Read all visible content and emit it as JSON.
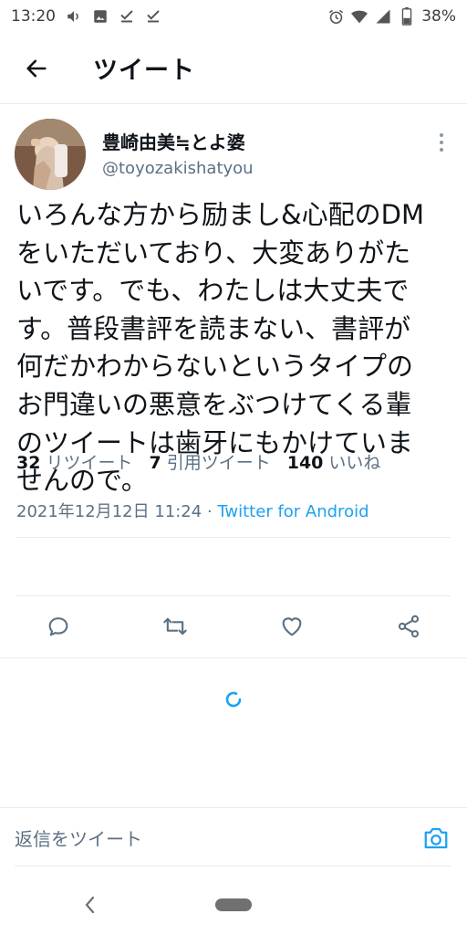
{
  "status_bar": {
    "time": "13:20",
    "battery": "38%"
  },
  "app_bar": {
    "title": "ツイート"
  },
  "tweet": {
    "author_name": "豊崎由美≒とよ婆",
    "author_handle": "@toyozakishatyou",
    "text_lines": [
      "いろんな方から励まし&心配のDM",
      "をいただいており、大変ありがた",
      "いです。でも、わたしは大丈夫で",
      "す。普段書評を読まない、書評が",
      "何だかわからないというタイプの",
      "お門違いの悪意をぶつけてくる輩",
      "のツイートは歯牙にもかけていま",
      "せんので。"
    ],
    "date": "2021年12月12日 11:24",
    "separator": " · ",
    "source": "Twitter for Android",
    "stats": {
      "retweets_count": "32",
      "retweets_label": "リツイート",
      "quotes_count": "7",
      "quotes_label": "引用ツイート",
      "likes_count": "140",
      "likes_label": "いいね"
    }
  },
  "reply": {
    "placeholder": "返信をツイート"
  },
  "icons": {
    "back": "arrow-left-icon",
    "more": "more-vertical-icon",
    "reply": "comment-icon",
    "retweet": "retweet-icon",
    "like": "heart-icon",
    "share": "share-icon",
    "camera": "camera-icon"
  },
  "colors": {
    "accent": "#1da1f2",
    "secondary_text": "#5b7083",
    "divider": "#e6ecf0"
  }
}
